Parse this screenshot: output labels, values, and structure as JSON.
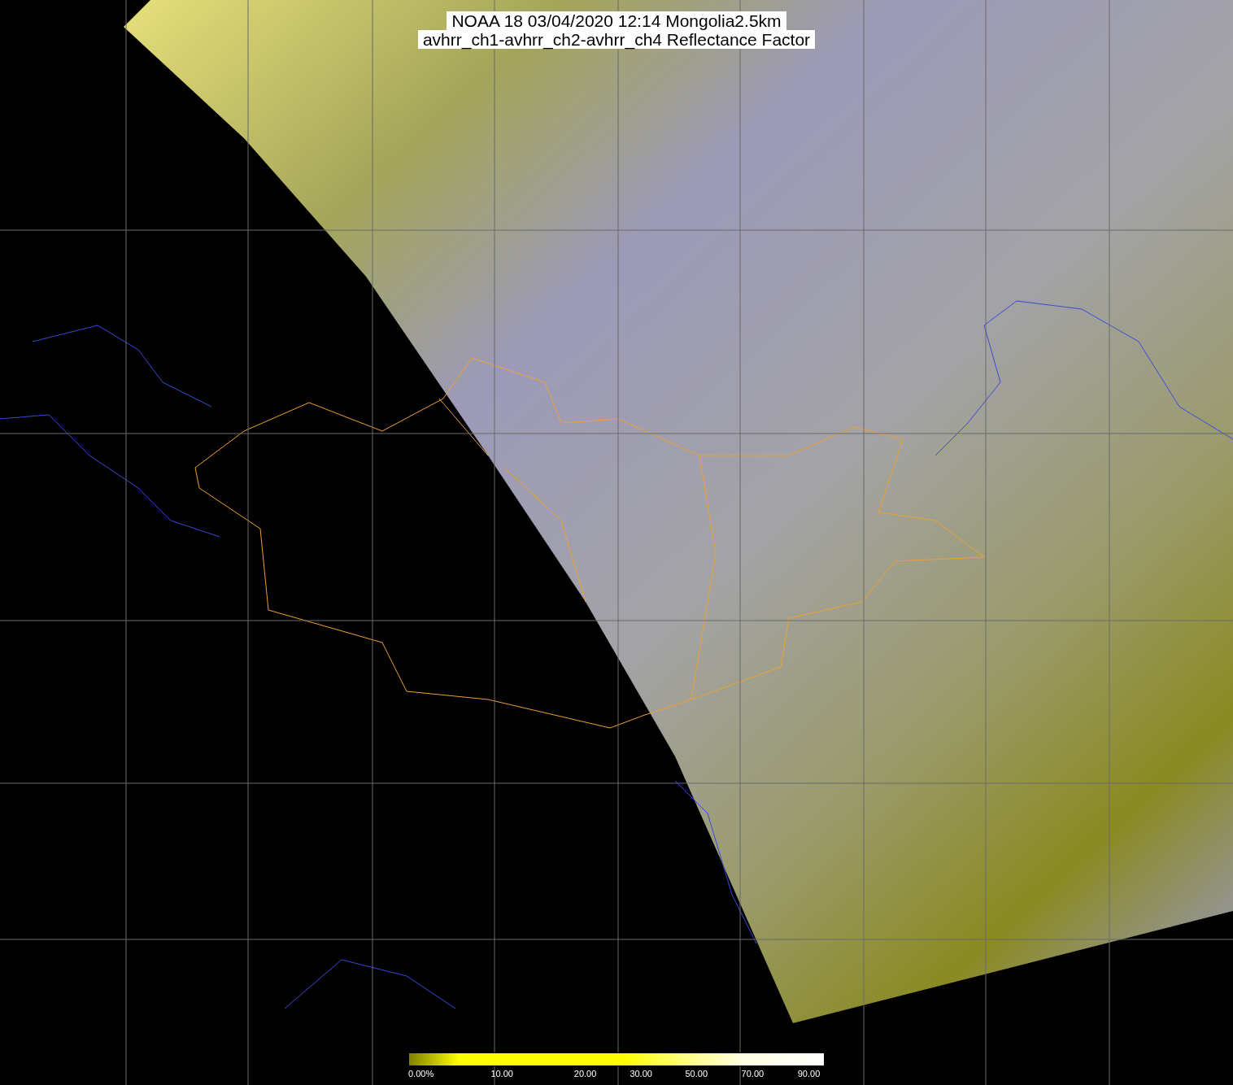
{
  "title": {
    "lines": [
      "NOAA 18 03/04/2020 12:14 Mongolia2.5km",
      "avhrr_ch1-avhrr_ch2-avhrr_ch4 Reflectance Factor"
    ]
  },
  "colorbar": {
    "labels": [
      "0.00%",
      "10.00",
      "20.00",
      "30.00",
      "50.00",
      "70.00",
      "90.00"
    ]
  }
}
